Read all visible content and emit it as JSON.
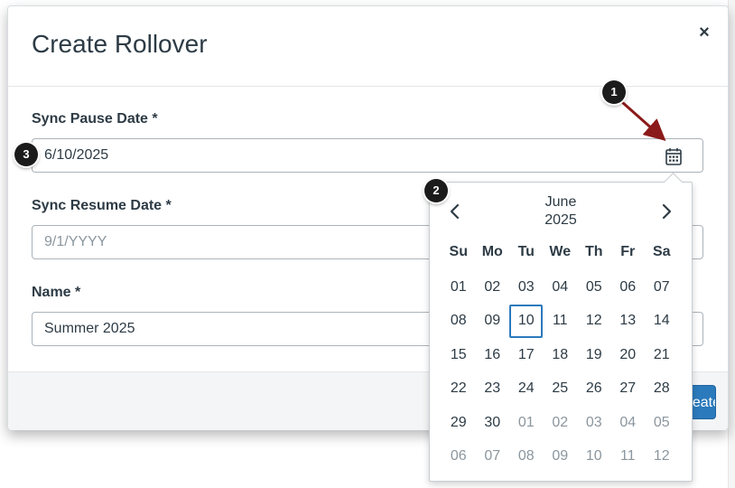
{
  "modal": {
    "title": "Create Rollover",
    "close_label": "×"
  },
  "fields": {
    "sync_pause": {
      "label": "Sync Pause Date *",
      "value": "6/10/2025"
    },
    "sync_resume": {
      "label": "Sync Resume Date *",
      "placeholder": "9/1/YYYY"
    },
    "name": {
      "label": "Name *",
      "value": "Summer 2025"
    }
  },
  "footer": {
    "create_label": "Create"
  },
  "calendar": {
    "month": "June",
    "year": "2025",
    "weekdays": [
      "Su",
      "Mo",
      "Tu",
      "We",
      "Th",
      "Fr",
      "Sa"
    ],
    "weeks": [
      [
        "01",
        "02",
        "03",
        "04",
        "05",
        "06",
        "07"
      ],
      [
        "08",
        "09",
        "10",
        "11",
        "12",
        "13",
        "14"
      ],
      [
        "15",
        "16",
        "17",
        "18",
        "19",
        "20",
        "21"
      ],
      [
        "22",
        "23",
        "24",
        "25",
        "26",
        "27",
        "28"
      ],
      [
        "29",
        "30",
        "01",
        "02",
        "03",
        "04",
        "05"
      ],
      [
        "06",
        "07",
        "08",
        "09",
        "10",
        "11",
        "12"
      ]
    ],
    "selected_day": "10"
  },
  "annotations": [
    "1",
    "2",
    "3"
  ],
  "colors": {
    "accent": "#2b7abc",
    "annotation_arrow": "#8b1a1a",
    "badge": "#1b1b1b"
  }
}
